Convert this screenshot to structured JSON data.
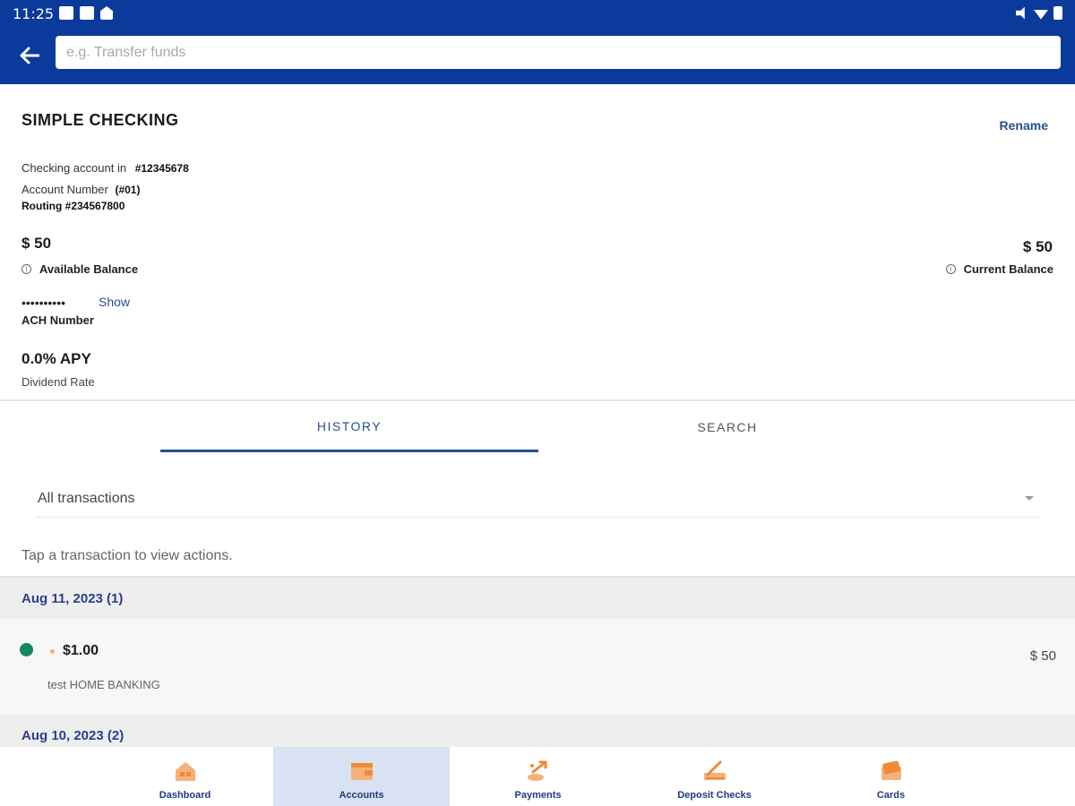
{
  "status_bar": {
    "time": "11:25"
  },
  "search": {
    "placeholder": "e.g. Transfer funds"
  },
  "account": {
    "title": "SIMPLE CHECKING",
    "rename_label": "Rename",
    "checking_label": "Checking account in",
    "checking_number": "#12345678",
    "account_number_label": "Account Number",
    "account_number": "(#01)",
    "routing": "Routing #234567800",
    "available_balance": "$ 50",
    "available_balance_label": "Available Balance",
    "current_balance": "$ 50",
    "current_balance_label": "Current Balance",
    "ach_masked": "••••••••••",
    "show_label": "Show",
    "ach_label": "ACH Number",
    "apy": "0.0% APY",
    "apy_label": "Dividend Rate"
  },
  "tabs": [
    {
      "label": "HISTORY",
      "active": true
    },
    {
      "label": "SEARCH",
      "active": false
    }
  ],
  "filter": {
    "selected": "All transactions"
  },
  "hint": "Tap a transaction to view actions.",
  "transactions": {
    "groups": [
      {
        "date": "Aug 11, 2023 (1)",
        "items": [
          {
            "amount": "$1.00",
            "description": "test HOME BANKING",
            "balance": "$ 50",
            "status_color": "#16875a"
          }
        ]
      },
      {
        "date": "Aug 10, 2023 (2)",
        "items": []
      }
    ]
  },
  "bottom_nav": [
    {
      "label": "Dashboard",
      "icon": "dashboard-icon",
      "active": false
    },
    {
      "label": "Accounts",
      "icon": "wallet-icon",
      "active": true
    },
    {
      "label": "Payments",
      "icon": "payments-icon",
      "active": false
    },
    {
      "label": "Deposit Checks",
      "icon": "deposit-check-icon",
      "active": false
    },
    {
      "label": "Cards",
      "icon": "cards-icon",
      "active": false
    }
  ],
  "colors": {
    "brand": "#0a3a9b",
    "link": "#2a4e8f",
    "accent_icon": "#ef8a36",
    "active_nav_bg": "#d8e2f2",
    "status_green": "#16875a"
  }
}
